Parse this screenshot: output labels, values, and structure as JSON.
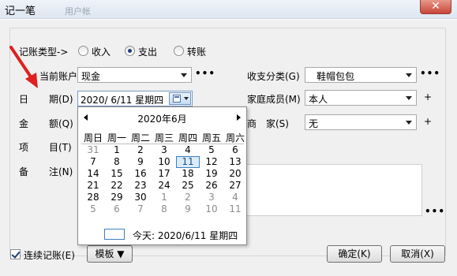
{
  "window": {
    "title": "记一笔",
    "ghost_text": "用户帐",
    "close_label": "✕"
  },
  "form": {
    "type_label": "记账类型->",
    "radios": [
      {
        "label": "收入",
        "checked": false
      },
      {
        "label": "支出",
        "checked": true
      },
      {
        "label": "转账",
        "checked": false
      }
    ],
    "account_label": "当前账户",
    "account_value": "现金",
    "category_label": "收支分类(G)",
    "category_value": "鞋帽包包",
    "date_label_1": "日",
    "date_label_2": "期(D)",
    "date_value": "2020/ 6/11 星期四",
    "member_label": "家庭成员(M)",
    "member_value": "本人",
    "amount_label_1": "金",
    "amount_label_2": "额(Q)",
    "merchant_label_1": "商",
    "merchant_label_2": "家(S)",
    "merchant_value": "无",
    "item_label_1": "项",
    "item_label_2": "目(T)",
    "note_label_1": "备",
    "note_label_2": "注(N)",
    "ellipsis": "•••",
    "plus": "+"
  },
  "calendar": {
    "month_title": "2020年6月",
    "weekdays": [
      "周日",
      "周一",
      "周二",
      "周三",
      "周四",
      "周五",
      "周六"
    ],
    "days": [
      {
        "d": "31",
        "other": true
      },
      {
        "d": "1"
      },
      {
        "d": "2"
      },
      {
        "d": "3"
      },
      {
        "d": "4"
      },
      {
        "d": "5"
      },
      {
        "d": "6"
      },
      {
        "d": "7"
      },
      {
        "d": "8"
      },
      {
        "d": "9"
      },
      {
        "d": "10"
      },
      {
        "d": "11",
        "today": true
      },
      {
        "d": "12"
      },
      {
        "d": "13"
      },
      {
        "d": "14"
      },
      {
        "d": "15"
      },
      {
        "d": "16"
      },
      {
        "d": "17"
      },
      {
        "d": "18"
      },
      {
        "d": "19"
      },
      {
        "d": "20"
      },
      {
        "d": "21"
      },
      {
        "d": "22"
      },
      {
        "d": "23"
      },
      {
        "d": "24"
      },
      {
        "d": "25"
      },
      {
        "d": "26"
      },
      {
        "d": "27"
      },
      {
        "d": "28"
      },
      {
        "d": "29"
      },
      {
        "d": "30"
      },
      {
        "d": "1",
        "other": true
      },
      {
        "d": "2",
        "other": true
      },
      {
        "d": "3",
        "other": true
      },
      {
        "d": "4",
        "other": true
      },
      {
        "d": "5",
        "other": true
      },
      {
        "d": "6",
        "other": true
      },
      {
        "d": "7",
        "other": true
      },
      {
        "d": "8",
        "other": true
      },
      {
        "d": "9",
        "other": true
      },
      {
        "d": "10",
        "other": true
      },
      {
        "d": "11",
        "other": true
      }
    ],
    "today_text": "今天: 2020/6/11 星期四"
  },
  "bottom": {
    "continuous_label": "连续记账(E)",
    "continuous_checked": true,
    "template_label": "模板 ▼",
    "ok_label": "确定(K)",
    "cancel_label": "取消(X)"
  },
  "colors": {
    "accent": "#3b7fc4",
    "annotation_arrow": "#e02020"
  }
}
